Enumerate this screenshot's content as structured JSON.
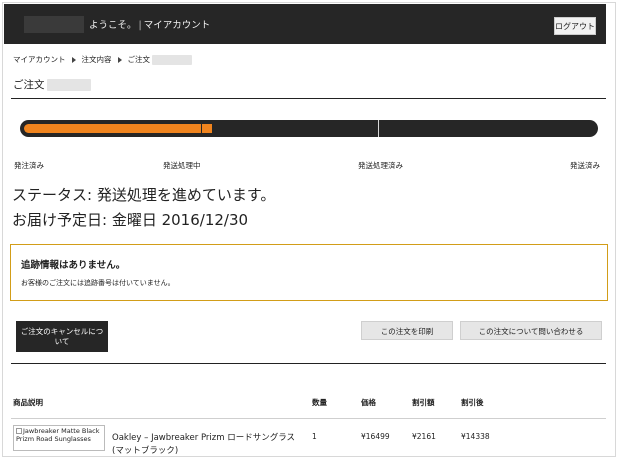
{
  "header": {
    "welcome": "ようこそ。",
    "separator": "|",
    "my_account": "マイアカウント",
    "logout_label": "ログアウト"
  },
  "breadcrumb": {
    "items": [
      "マイアカウント",
      "注文内容",
      "ご注文"
    ]
  },
  "order": {
    "title": "ご注文"
  },
  "progress": {
    "fraction": 0.33,
    "steps": [
      "発注済み",
      "発送処理中",
      "発送処理済み",
      "発送済み"
    ]
  },
  "status": {
    "line1": "ステータス: 発送処理を進めています。",
    "line2": "お届け予定日: 金曜日 2016/12/30"
  },
  "tracking": {
    "heading": "追跡情報はありません。",
    "message": "お客様のご注文には追跡番号は付いていません。"
  },
  "buttons": {
    "cancel": "ご注文のキャンセルについて",
    "print": "この注文を印刷",
    "contact": "この注文について問い合わせる"
  },
  "table": {
    "headers": [
      "商品説明",
      "数量",
      "価格",
      "割引額",
      "割引後"
    ],
    "rows": [
      {
        "image_alt": "Jawbreaker Matte Black Prizm Road Sunglasses",
        "name": "Oakley – Jawbreaker Prizm ロードサングラス (マットブラック)",
        "qty": "1",
        "price": "¥16499",
        "discount": "¥2161",
        "after": "¥14338"
      }
    ]
  },
  "colors": {
    "header_bg": "#262626",
    "progress_fill": "#f0841e",
    "tracking_border": "#d29d18"
  }
}
